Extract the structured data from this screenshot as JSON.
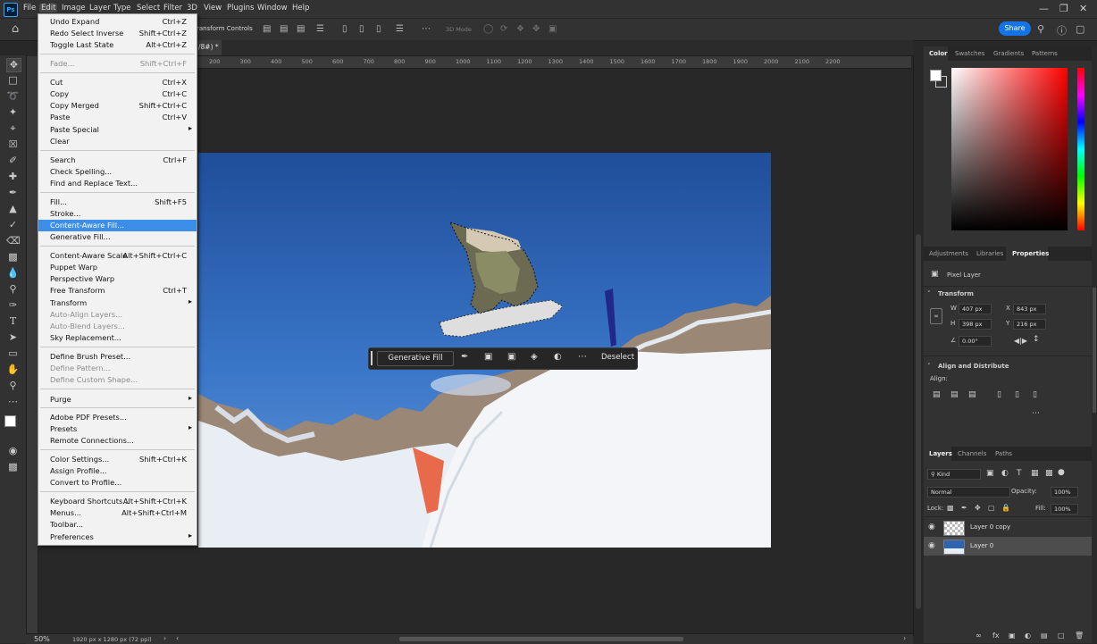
{
  "app": {
    "logo": "Ps"
  },
  "menubar": {
    "items": [
      "File",
      "Edit",
      "Image",
      "Layer",
      "Type",
      "Select",
      "Filter",
      "3D",
      "View",
      "Plugins",
      "Window",
      "Help"
    ]
  },
  "optionsbar": {
    "transform_label": "ransform Controls",
    "mode3d": "3D Mode",
    "share": "Share"
  },
  "document": {
    "tab_title": "/8#) *"
  },
  "ruler": {
    "ticks": [
      "200",
      "300",
      "400",
      "500",
      "600",
      "700",
      "800",
      "900",
      "1000",
      "1100",
      "1200",
      "1300",
      "1400",
      "1500",
      "1600",
      "1700",
      "1800",
      "1900",
      "2000",
      "2100",
      "2200"
    ]
  },
  "edit_menu": {
    "items": [
      {
        "label": "Undo Expand",
        "shortcut": "Ctrl+Z"
      },
      {
        "label": "Redo Select Inverse",
        "shortcut": "Shift+Ctrl+Z"
      },
      {
        "label": "Toggle Last State",
        "shortcut": "Alt+Ctrl+Z"
      },
      {
        "label": "Fade...",
        "shortcut": "Shift+Ctrl+F",
        "disabled": true
      },
      {
        "label": "Cut",
        "shortcut": "Ctrl+X"
      },
      {
        "label": "Copy",
        "shortcut": "Ctrl+C"
      },
      {
        "label": "Copy Merged",
        "shortcut": "Shift+Ctrl+C"
      },
      {
        "label": "Paste",
        "shortcut": "Ctrl+V"
      },
      {
        "label": "Paste Special",
        "shortcut": "",
        "submenu": true
      },
      {
        "label": "Clear",
        "shortcut": ""
      },
      {
        "label": "Search",
        "shortcut": "Ctrl+F"
      },
      {
        "label": "Check Spelling...",
        "shortcut": ""
      },
      {
        "label": "Find and Replace Text...",
        "shortcut": ""
      },
      {
        "label": "Fill...",
        "shortcut": "Shift+F5"
      },
      {
        "label": "Stroke...",
        "shortcut": ""
      },
      {
        "label": "Content-Aware Fill...",
        "shortcut": "",
        "highlighted": true
      },
      {
        "label": "Generative Fill...",
        "shortcut": ""
      },
      {
        "label": "Content-Aware Scale",
        "shortcut": "Alt+Shift+Ctrl+C"
      },
      {
        "label": "Puppet Warp",
        "shortcut": ""
      },
      {
        "label": "Perspective Warp",
        "shortcut": ""
      },
      {
        "label": "Free Transform",
        "shortcut": "Ctrl+T"
      },
      {
        "label": "Transform",
        "shortcut": "",
        "submenu": true
      },
      {
        "label": "Auto-Align Layers...",
        "shortcut": "",
        "disabled": true
      },
      {
        "label": "Auto-Blend Layers...",
        "shortcut": "",
        "disabled": true
      },
      {
        "label": "Sky Replacement...",
        "shortcut": ""
      },
      {
        "label": "Define Brush Preset...",
        "shortcut": ""
      },
      {
        "label": "Define Pattern...",
        "shortcut": "",
        "disabled": true
      },
      {
        "label": "Define Custom Shape...",
        "shortcut": "",
        "disabled": true
      },
      {
        "label": "Purge",
        "shortcut": "",
        "submenu": true
      },
      {
        "label": "Adobe PDF Presets...",
        "shortcut": ""
      },
      {
        "label": "Presets",
        "shortcut": "",
        "submenu": true
      },
      {
        "label": "Remote Connections...",
        "shortcut": ""
      },
      {
        "label": "Color Settings...",
        "shortcut": "Shift+Ctrl+K"
      },
      {
        "label": "Assign Profile...",
        "shortcut": ""
      },
      {
        "label": "Convert to Profile...",
        "shortcut": ""
      },
      {
        "label": "Keyboard Shortcuts...",
        "shortcut": "Alt+Shift+Ctrl+K"
      },
      {
        "label": "Menus...",
        "shortcut": "Alt+Shift+Ctrl+M"
      },
      {
        "label": "Toolbar...",
        "shortcut": ""
      },
      {
        "label": "Preferences",
        "shortcut": "",
        "submenu": true
      }
    ]
  },
  "contextbar": {
    "generative_fill": "Generative Fill",
    "deselect": "Deselect"
  },
  "color_panel": {
    "tabs": [
      "Color",
      "Swatches",
      "Gradients",
      "Patterns"
    ],
    "hue": "#ff0000"
  },
  "properties_panel": {
    "tabs": [
      "Adjustments",
      "Libraries",
      "Properties"
    ],
    "layer_type": "Pixel Layer",
    "transform_title": "Transform",
    "w": "407 px",
    "h": "398 px",
    "x": "843 px",
    "y": "216 px",
    "angle": "0.00°",
    "align_title": "Align and Distribute",
    "align_label": "Align:"
  },
  "layers_panel": {
    "tabs": [
      "Layers",
      "Channels",
      "Paths"
    ],
    "kind": "Kind",
    "blend_mode": "Normal",
    "opacity_label": "Opacity:",
    "opacity": "100%",
    "lock_label": "Lock:",
    "fill_label": "Fill:",
    "fill": "100%",
    "layers": [
      {
        "name": "Layer 0 copy"
      },
      {
        "name": "Layer 0"
      }
    ]
  },
  "status": {
    "zoom": "50%",
    "doc_info": "1920 px x 1280 px (72 ppi)"
  }
}
